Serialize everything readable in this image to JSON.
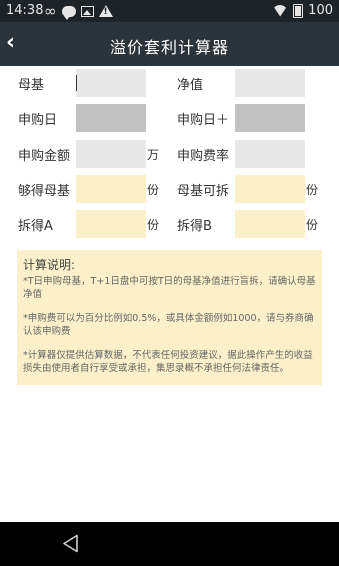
{
  "status_bar": {
    "time": "14:38",
    "battery_level": "100",
    "icons": [
      "infinity-icon",
      "message-icon",
      "photo-icon",
      "warning-icon",
      "wifi-icon",
      "battery-icon"
    ]
  },
  "header": {
    "back_glyph": "‹",
    "title": "溢价套利计算器"
  },
  "form": {
    "muji": {
      "label": "母基",
      "value": ""
    },
    "jingzhi": {
      "label": "净值",
      "value": ""
    },
    "shengou_ri": {
      "label": "申购日",
      "value": ""
    },
    "shengou_ri_plus": {
      "label": "申购日＋",
      "value": ""
    },
    "shengou_jine": {
      "label": "申购金额",
      "value": "",
      "unit": "万"
    },
    "shengou_feilv": {
      "label": "申购费率",
      "value": ""
    },
    "goude_muji": {
      "label": "够得母基",
      "value": "",
      "unit": "份"
    },
    "muji_kechai": {
      "label": "母基可拆",
      "value": "",
      "unit": "份"
    },
    "chaide_a": {
      "label": "拆得A",
      "value": "",
      "unit": "份"
    },
    "chaide_b": {
      "label": "拆得B",
      "value": "",
      "unit": "份"
    }
  },
  "notes": {
    "title": "计算说明:",
    "items": [
      "*T日申购母基，T+1日盘中可按T日的母基净值进行盲拆，请确认母基净值",
      "*申购费可以为百分比例如0.5%，或具体金额例如1000，请与券商确认该申购费",
      "*计算器仅提供估算数据，不代表任何投资建议，据此操作产生的收益损失由使用者自行享受或承担，集思录概不承担任何法律责任。"
    ]
  },
  "colors": {
    "title_bar": "#2b333b",
    "status_bar": "#1e2327",
    "input_grey": "#e8e8e8",
    "input_dark": "#c2c2c2",
    "result_yellow": "#fbf0c9"
  }
}
